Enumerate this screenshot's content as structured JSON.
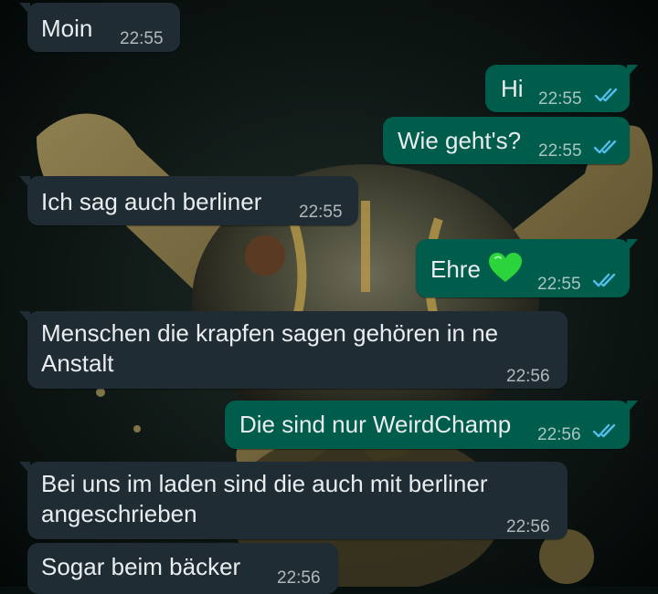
{
  "colors": {
    "incoming_bubble": "#1f2c34",
    "outgoing_bubble": "#005c4b",
    "text": "#e9edef",
    "read_ticks": "#53bdeb",
    "heart": "#2bd43a"
  },
  "messages": [
    {
      "direction": "in",
      "text": "Moin",
      "time": "22:55"
    },
    {
      "direction": "out",
      "text": "Hi",
      "time": "22:55",
      "status": "read"
    },
    {
      "direction": "out",
      "text": "Wie geht's?",
      "time": "22:55",
      "status": "read"
    },
    {
      "direction": "in",
      "text": "Ich sag auch berliner",
      "time": "22:55"
    },
    {
      "direction": "out",
      "text": "Ehre",
      "emoji": "green-heart",
      "time": "22:55",
      "status": "read"
    },
    {
      "direction": "in",
      "text": "Menschen die krapfen sagen gehören in ne Anstalt",
      "time": "22:56"
    },
    {
      "direction": "out",
      "text": "Die sind nur WeirdChamp",
      "time": "22:56",
      "status": "read"
    },
    {
      "direction": "in",
      "text": "Bei uns im laden sind die auch mit berliner angeschrieben",
      "time": "22:56"
    },
    {
      "direction": "in",
      "text": "Sogar beim bäcker",
      "time": "22:56"
    }
  ]
}
